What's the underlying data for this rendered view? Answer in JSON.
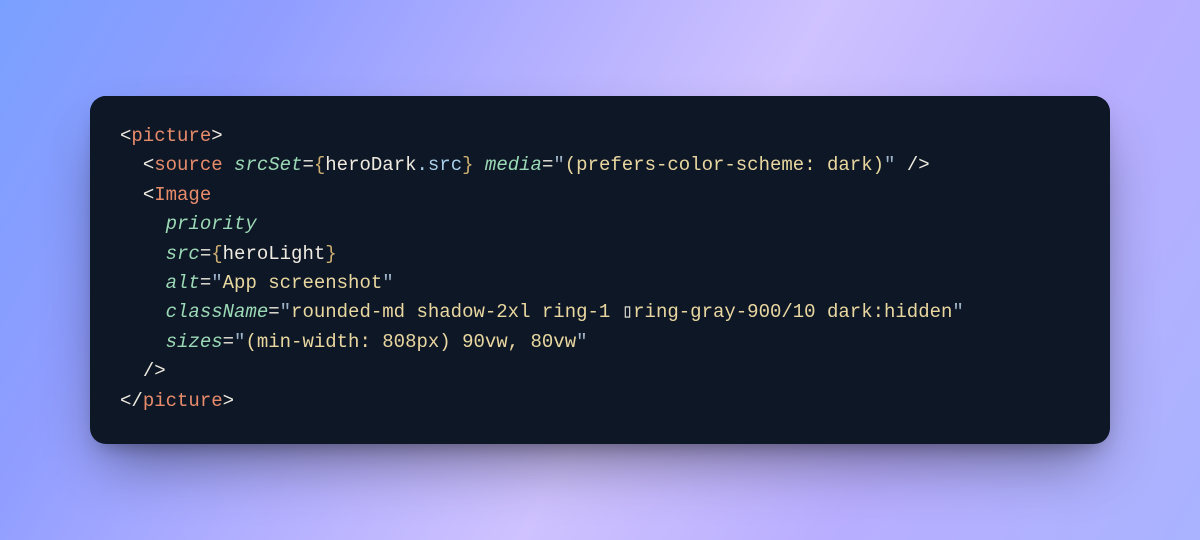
{
  "code": {
    "lines": [
      {
        "indent": 0,
        "segments": [
          {
            "cls": "punc",
            "t": "<"
          },
          {
            "cls": "tag",
            "t": "picture"
          },
          {
            "cls": "punc",
            "t": ">"
          }
        ]
      },
      {
        "indent": 1,
        "segments": [
          {
            "cls": "punc",
            "t": "<"
          },
          {
            "cls": "tag",
            "t": "source"
          },
          {
            "cls": "punc",
            "t": " "
          },
          {
            "cls": "attr",
            "t": "srcSet"
          },
          {
            "cls": "punc",
            "t": "="
          },
          {
            "cls": "brace",
            "t": "{"
          },
          {
            "cls": "expr",
            "t": "heroDark"
          },
          {
            "cls": "prop",
            "t": ".src"
          },
          {
            "cls": "brace",
            "t": "}"
          },
          {
            "cls": "punc",
            "t": " "
          },
          {
            "cls": "attr",
            "t": "media"
          },
          {
            "cls": "punc",
            "t": "="
          },
          {
            "cls": "q",
            "t": "\""
          },
          {
            "cls": "str",
            "t": "(prefers-color-scheme: dark)"
          },
          {
            "cls": "q",
            "t": "\""
          },
          {
            "cls": "punc",
            "t": " />"
          }
        ]
      },
      {
        "indent": 1,
        "segments": [
          {
            "cls": "punc",
            "t": "<"
          },
          {
            "cls": "tag",
            "t": "Image"
          }
        ]
      },
      {
        "indent": 2,
        "segments": [
          {
            "cls": "attr",
            "t": "priority"
          }
        ]
      },
      {
        "indent": 2,
        "segments": [
          {
            "cls": "attr",
            "t": "src"
          },
          {
            "cls": "punc",
            "t": "="
          },
          {
            "cls": "brace",
            "t": "{"
          },
          {
            "cls": "expr",
            "t": "heroLight"
          },
          {
            "cls": "brace",
            "t": "}"
          }
        ]
      },
      {
        "indent": 2,
        "segments": [
          {
            "cls": "attr",
            "t": "alt"
          },
          {
            "cls": "punc",
            "t": "="
          },
          {
            "cls": "q",
            "t": "\""
          },
          {
            "cls": "str",
            "t": "App screenshot"
          },
          {
            "cls": "q",
            "t": "\""
          }
        ]
      },
      {
        "indent": 2,
        "segments": [
          {
            "cls": "attr",
            "t": "className"
          },
          {
            "cls": "punc",
            "t": "="
          },
          {
            "cls": "q",
            "t": "\""
          },
          {
            "cls": "str",
            "t": "rounded-md shadow-2xl ring-1 "
          },
          {
            "cls": "box",
            "t": "▯"
          },
          {
            "cls": "str",
            "t": "ring-gray-900/10 dark:hidden"
          },
          {
            "cls": "q",
            "t": "\""
          }
        ]
      },
      {
        "indent": 2,
        "segments": [
          {
            "cls": "attr",
            "t": "sizes"
          },
          {
            "cls": "punc",
            "t": "="
          },
          {
            "cls": "q",
            "t": "\""
          },
          {
            "cls": "str",
            "t": "(min-width: 808px) 90vw, 80vw"
          },
          {
            "cls": "q",
            "t": "\""
          }
        ]
      },
      {
        "indent": 1,
        "segments": [
          {
            "cls": "punc",
            "t": "/>"
          }
        ]
      },
      {
        "indent": 0,
        "segments": [
          {
            "cls": "punc",
            "t": "</"
          },
          {
            "cls": "tag",
            "t": "picture"
          },
          {
            "cls": "punc",
            "t": ">"
          }
        ]
      }
    ],
    "indent_unit": "  "
  }
}
